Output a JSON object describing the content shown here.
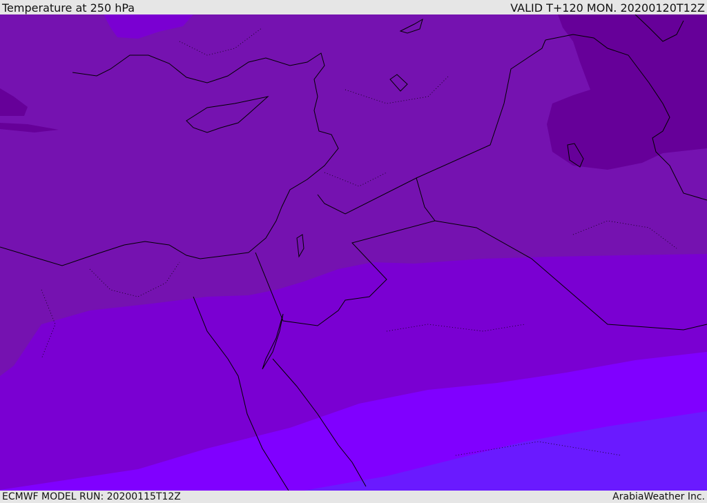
{
  "header": {
    "title": "Temperature at 250 hPa",
    "valid": "VALID T+120 MON. 20200120T12Z"
  },
  "footer": {
    "model_run": "ECMWF MODEL RUN: 20200115T12Z",
    "credit": "ArabiaWeather Inc."
  },
  "map": {
    "palette": {
      "coldest": "#660099",
      "cold": "#7512b0",
      "mid": "#7a00d2",
      "warm": "#8000ff",
      "warmest": "#6a1aff"
    },
    "border_color": "#000000"
  }
}
